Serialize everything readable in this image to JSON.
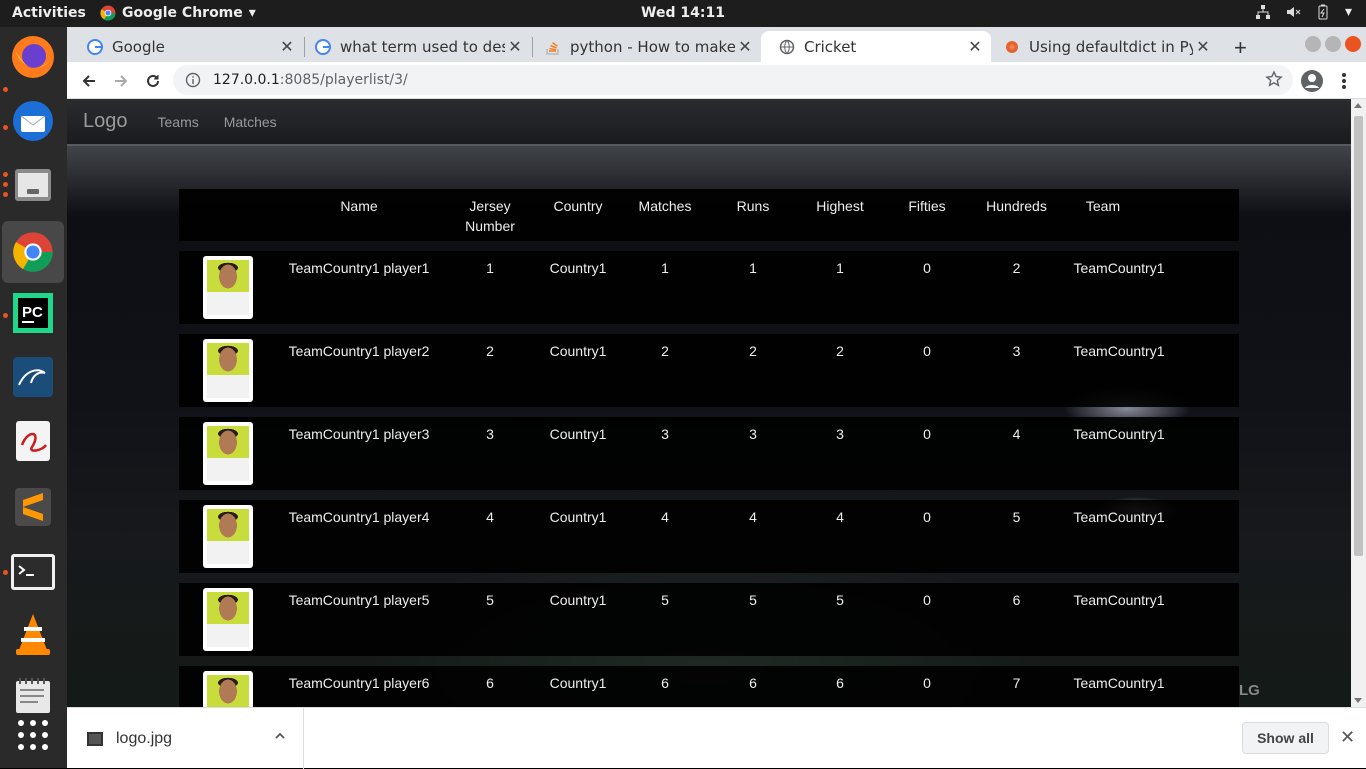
{
  "topbar": {
    "activities": "Activities",
    "app_name": "Google Chrome",
    "clock": "Wed 14:11"
  },
  "dock": {
    "items": [
      "firefox-icon",
      "thunderbird-icon",
      "files-icon",
      "chrome-icon",
      "pycharm-icon",
      "mysql-workbench-icon",
      "document-viewer-icon",
      "sublime-text-icon",
      "terminal-icon",
      "vlc-icon",
      "text-editor-icon",
      "show-applications-icon"
    ]
  },
  "tabs": [
    {
      "title": "Google",
      "icon": "google-icon",
      "active": false
    },
    {
      "title": "what term used to describe",
      "icon": "google-icon",
      "active": false
    },
    {
      "title": "python - How to make dict",
      "icon": "stackoverflow-icon",
      "active": false
    },
    {
      "title": "Cricket",
      "icon": "globe-icon",
      "active": true
    },
    {
      "title": "Using defaultdict in Python",
      "icon": "realpython-icon",
      "active": false
    }
  ],
  "addressbar": {
    "url_host": "127.0.0.1",
    "url_path": ":8085/playerlist/3/"
  },
  "site": {
    "brand": "Logo",
    "nav": [
      "Teams",
      "Matches"
    ],
    "watermark": "LG"
  },
  "table": {
    "headers": {
      "name": "Name",
      "jersey": "Jersey Number",
      "country": "Country",
      "matches": "Matches",
      "runs": "Runs",
      "highest": "Highest",
      "fifties": "Fifties",
      "hundreds": "Hundreds",
      "team": "Team"
    },
    "rows": [
      {
        "name": "TeamCountry1 player1",
        "jersey": "1",
        "country": "Country1",
        "matches": "1",
        "runs": "1",
        "highest": "1",
        "fifties": "0",
        "hundreds": "2",
        "team": "TeamCountry1"
      },
      {
        "name": "TeamCountry1 player2",
        "jersey": "2",
        "country": "Country1",
        "matches": "2",
        "runs": "2",
        "highest": "2",
        "fifties": "0",
        "hundreds": "3",
        "team": "TeamCountry1"
      },
      {
        "name": "TeamCountry1 player3",
        "jersey": "3",
        "country": "Country1",
        "matches": "3",
        "runs": "3",
        "highest": "3",
        "fifties": "0",
        "hundreds": "4",
        "team": "TeamCountry1"
      },
      {
        "name": "TeamCountry1 player4",
        "jersey": "4",
        "country": "Country1",
        "matches": "4",
        "runs": "4",
        "highest": "4",
        "fifties": "0",
        "hundreds": "5",
        "team": "TeamCountry1"
      },
      {
        "name": "TeamCountry1 player5",
        "jersey": "5",
        "country": "Country1",
        "matches": "5",
        "runs": "5",
        "highest": "5",
        "fifties": "0",
        "hundreds": "6",
        "team": "TeamCountry1"
      },
      {
        "name": "TeamCountry1 player6",
        "jersey": "6",
        "country": "Country1",
        "matches": "6",
        "runs": "6",
        "highest": "6",
        "fifties": "0",
        "hundreds": "7",
        "team": "TeamCountry1"
      }
    ]
  },
  "downloads": {
    "file": "logo.jpg",
    "show_all": "Show all"
  },
  "colors": {
    "ubuntu_orange": "#e95420",
    "dock_bg": "#2a2a2a",
    "tabstrip_bg": "#dee1e6"
  }
}
